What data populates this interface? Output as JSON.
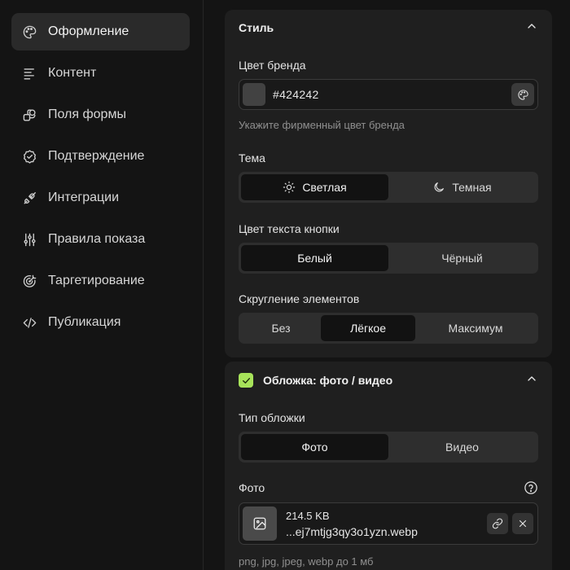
{
  "sidebar": {
    "items": [
      {
        "label": "Оформление",
        "icon": "palette-icon",
        "active": true
      },
      {
        "label": "Контент",
        "icon": "text-lines-icon"
      },
      {
        "label": "Поля формы",
        "icon": "shapes-icon"
      },
      {
        "label": "Подтверждение",
        "icon": "badge-check-icon"
      },
      {
        "label": "Интеграции",
        "icon": "plug-icon"
      },
      {
        "label": "Правила показа",
        "icon": "sliders-icon"
      },
      {
        "label": "Таргетирование",
        "icon": "target-icon"
      },
      {
        "label": "Публикация",
        "icon": "code-icon"
      }
    ]
  },
  "style_section": {
    "title": "Стиль",
    "brand_color": {
      "label": "Цвет бренда",
      "value": "#424242",
      "hint": "Укажите фирменный цвет бренда"
    },
    "theme": {
      "label": "Тема",
      "options": [
        "Светлая",
        "Темная"
      ],
      "selected": "Светлая"
    },
    "button_text_color": {
      "label": "Цвет текста кнопки",
      "options": [
        "Белый",
        "Чёрный"
      ],
      "selected": "Белый"
    },
    "rounding": {
      "label": "Скругление элементов",
      "options": [
        "Без",
        "Лёгкое",
        "Максимум"
      ],
      "selected": "Лёгкое"
    }
  },
  "cover_section": {
    "title": "Обложка: фото / видео",
    "enabled": true,
    "cover_type": {
      "label": "Тип обложки",
      "options": [
        "Фото",
        "Видео"
      ],
      "selected": "Фото"
    },
    "photo": {
      "label": "Фото",
      "file_size": "214.5 KB",
      "file_name": "...ej7mtjg3qy3o1yzn.webp",
      "hint": "png, jpg, jpeg, webp до 1 мб"
    }
  },
  "colors": {
    "accent": "#a7e35a",
    "swatch": "#424242",
    "background": "#141414",
    "card": "#1f1f1f"
  }
}
